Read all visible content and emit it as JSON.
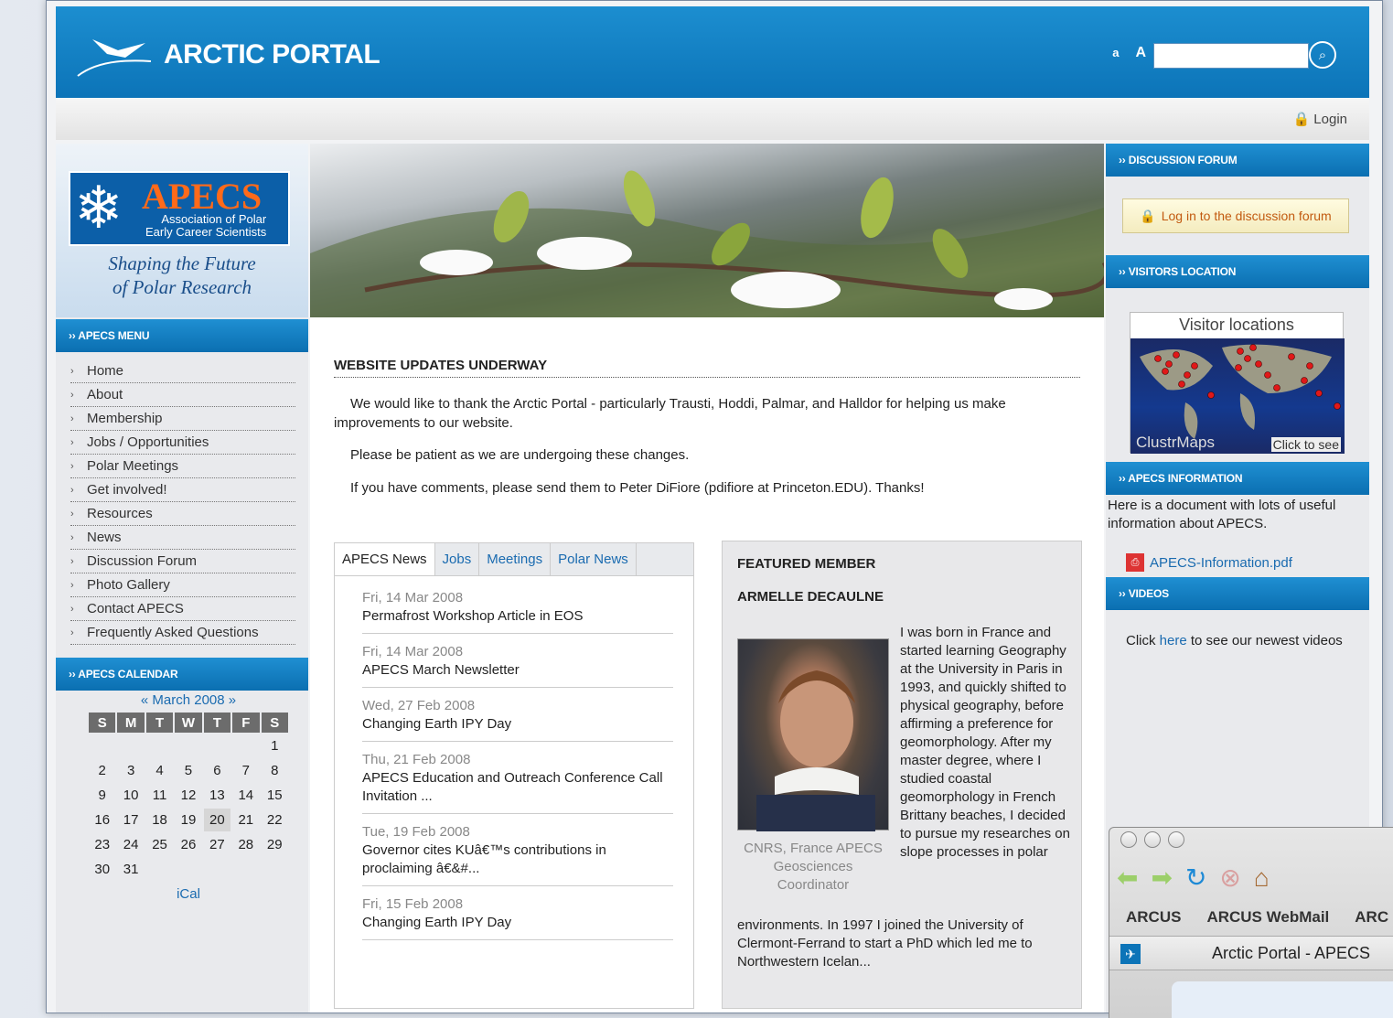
{
  "header": {
    "logo_text": "ARCTIC PORTAL",
    "font_small": "a",
    "font_large": "A",
    "search_placeholder": "",
    "login_label": "Login"
  },
  "sidebar": {
    "apecs_big": "APECS",
    "apecs_small_1": "Association of Polar",
    "apecs_small_2": "Early Career Scientists",
    "tagline_1": "Shaping the Future",
    "tagline_2": "of Polar Research",
    "menu_title": "APECS MENU",
    "menu": [
      "Home",
      "About",
      "Membership",
      "Jobs / Opportunities",
      "Polar Meetings",
      "Get involved!",
      "Resources",
      "News",
      "Discussion Forum",
      "Photo Gallery",
      "Contact APECS",
      "Frequently Asked Questions"
    ],
    "calendar_title": "APECS CALENDAR",
    "calendar_nav_prev": "«",
    "calendar_month": "March 2008",
    "calendar_nav_next": "»",
    "calendar_days": [
      "S",
      "M",
      "T",
      "W",
      "T",
      "F",
      "S"
    ],
    "calendar_weeks": [
      [
        "",
        "",
        "",
        "",
        "",
        "",
        "1"
      ],
      [
        "2",
        "3",
        "4",
        "5",
        "6",
        "7",
        "8"
      ],
      [
        "9",
        "10",
        "11",
        "12",
        "13",
        "14",
        "15"
      ],
      [
        "16",
        "17",
        "18",
        "19",
        "20",
        "21",
        "22"
      ],
      [
        "23",
        "24",
        "25",
        "26",
        "27",
        "28",
        "29"
      ],
      [
        "30",
        "31",
        "",
        "",
        "",
        "",
        ""
      ]
    ],
    "calendar_today": "20",
    "ical": "iCal"
  },
  "article": {
    "title": "WEBSITE UPDATES UNDERWAY",
    "p1": "We would like to thank the Arctic Portal - particularly Trausti, Hoddi, Palmar, and Halldor for helping us make improvements to our website.",
    "p2": "Please be patient as we are undergoing these changes.",
    "p3": "If you have comments, please send them to Peter DiFiore (pdifiore at Princeton.EDU). Thanks!"
  },
  "tabs": [
    "APECS News",
    "Jobs",
    "Meetings",
    "Polar News"
  ],
  "news": [
    {
      "date": "Fri, 14 Mar 2008",
      "title": "Permafrost Workshop Article in EOS"
    },
    {
      "date": "Fri, 14 Mar 2008",
      "title": "APECS March Newsletter"
    },
    {
      "date": "Wed, 27 Feb 2008",
      "title": "Changing Earth IPY Day"
    },
    {
      "date": "Thu, 21 Feb 2008",
      "title": "APECS Education and Outreach Conference Call Invitation ..."
    },
    {
      "date": "Tue, 19 Feb 2008",
      "title": "Governor cites KUâ€™s contributions in proclaiming â€&#..."
    },
    {
      "date": "Fri, 15 Feb 2008",
      "title": "Changing Earth IPY Day"
    }
  ],
  "featured": {
    "heading": "FEATURED MEMBER",
    "name": "ARMELLE DECAULNE",
    "caption": "CNRS, France APECS Geosciences Coordinator",
    "bio": "I was born in France and started learning Geography at the University in Paris in 1993, and quickly shifted to physical geography, before affirming a preference for geomorphology. After my master degree, where I studied coastal geomorphology in French Brittany beaches, I decided to pursue my researches on slope processes in polar",
    "bio_cont": "environments. In 1997 I joined the University of Clermont-Ferrand to start a PhD which led me to Northwestern Icelan..."
  },
  "right": {
    "forum_title": "DISCUSSION FORUM",
    "forum_button": "Log in to the discussion forum",
    "visitors_title": "VISITORS LOCATION",
    "map_title": "Visitor locations",
    "map_brand": "ClustrMaps",
    "map_click": "Click to see",
    "info_title": "APECS INFORMATION",
    "info_text": "Here is a document with lots of useful information about APECS.",
    "pdf": "APECS-Information.pdf",
    "videos_title": "VIDEOS",
    "videos_pre": "Click ",
    "videos_link": "here",
    "videos_post": " to see our newest videos"
  },
  "browser": {
    "bookmarks": [
      "ARCUS",
      "ARCUS WebMail",
      "ARC"
    ],
    "tab_title": "Arctic Portal - APECS"
  }
}
